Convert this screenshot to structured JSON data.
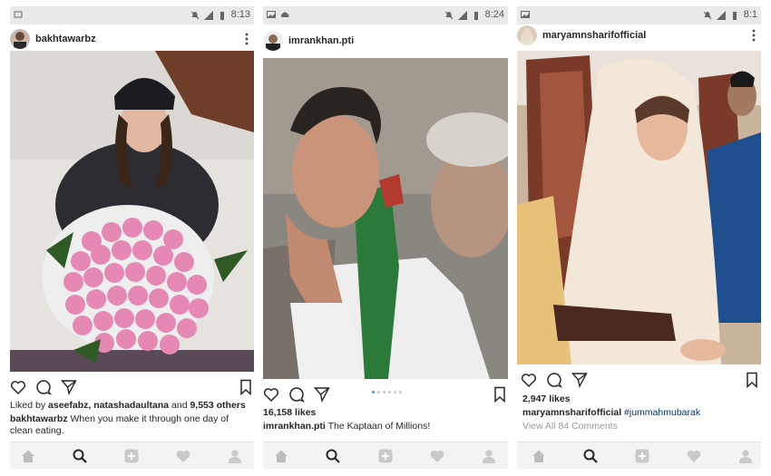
{
  "statusbar": {
    "p1_time": "8:13",
    "p2_time": "8:24",
    "p3_time": "8:1"
  },
  "posts": [
    {
      "username": "bakhtawarbz",
      "liked_by_prefix": "Liked by ",
      "liked_by_names": "aseefabz, natashadaultana",
      "liked_by_and": " and ",
      "liked_by_count": "9,553 others",
      "caption_user": "bakhtawarbz",
      "caption_text": " When you make it through one day of clean eating."
    },
    {
      "username": "imrankhan.pti",
      "likes": "16,158 likes",
      "caption_user": "imrankhan.pti",
      "caption_text": " The Kaptaan of Millions!"
    },
    {
      "username": "maryamnsharifofficial",
      "likes": "2,947 likes",
      "caption_user": "maryamnsharifofficial",
      "caption_tag": "#jummahmubarak",
      "comments": "View All 84 Comments"
    }
  ],
  "icons": {
    "statusbar": [
      "notification-icon",
      "mute-icon",
      "signal-icon",
      "battery-icon",
      "cloud-icon",
      "image-icon"
    ],
    "actions": [
      "heart-icon",
      "comment-icon",
      "share-icon",
      "bookmark-icon",
      "more-icon"
    ],
    "nav": [
      "home-icon",
      "search-icon",
      "add-icon",
      "activity-heart-icon",
      "profile-icon"
    ]
  },
  "colors": {
    "link": "#003569",
    "text": "#262626",
    "muted": "#999999",
    "carousel_active": "#3897f0"
  }
}
